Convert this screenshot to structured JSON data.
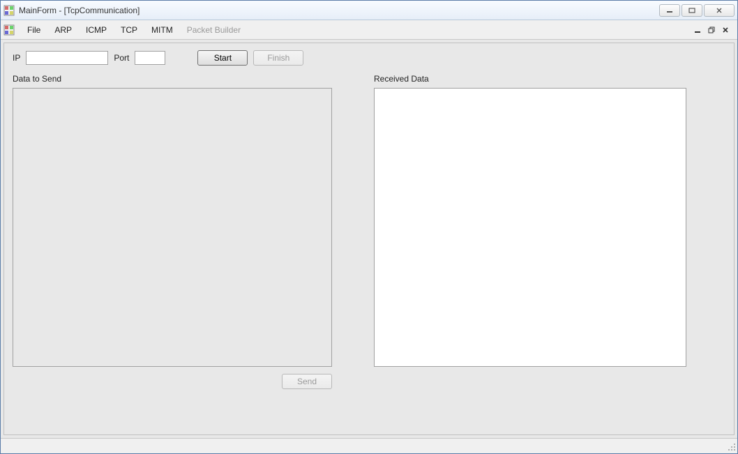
{
  "window": {
    "title": "MainForm - [TcpCommunication]"
  },
  "menu": {
    "file": "File",
    "arp": "ARP",
    "icmp": "ICMP",
    "tcp": "TCP",
    "mitm": "MITM",
    "packet_builder": "Packet Builder"
  },
  "controls": {
    "ip_label": "IP",
    "ip_value": "",
    "port_label": "Port",
    "port_value": "",
    "start_button": "Start",
    "finish_button": "Finish"
  },
  "panels": {
    "send_label": "Data to Send",
    "send_value": "",
    "recv_label": "Received Data",
    "recv_value": "",
    "send_button": "Send"
  }
}
